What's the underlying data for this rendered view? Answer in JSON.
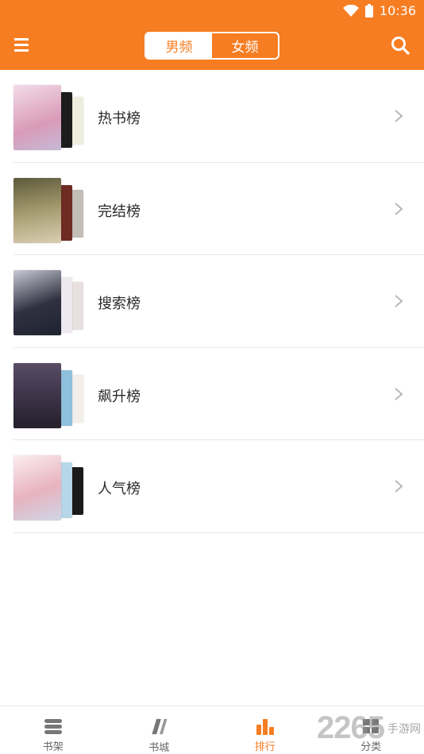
{
  "status_bar": {
    "time": "10:36",
    "wifi_icon": "wifi-icon",
    "battery_icon": "battery-icon"
  },
  "header": {
    "menu_icon": "menu-icon",
    "search_icon": "search-icon",
    "tabs": [
      {
        "label": "男频",
        "active": true
      },
      {
        "label": "女频",
        "active": false
      }
    ]
  },
  "rank_list": [
    {
      "label": "热书榜",
      "covers": [
        "#e9c6d8",
        "#1c1c1c",
        "#efeede"
      ]
    },
    {
      "label": "完结榜",
      "covers": [
        "#8a7a4a",
        "#6e2b22",
        "#c3bdb8"
      ]
    },
    {
      "label": "搜索榜",
      "covers": [
        "#2f3140",
        "#eee9ef",
        "#e8e0e0"
      ]
    },
    {
      "label": "飙升榜",
      "covers": [
        "#3d3448",
        "#8fc0dc",
        "#f2eeea"
      ]
    },
    {
      "label": "人气榜",
      "covers": [
        "#f3e0e2",
        "#b7d6e8",
        "#1a1a1a"
      ]
    }
  ],
  "bottom_nav": [
    {
      "label": "书架",
      "icon": "bookshelf-icon",
      "active": false
    },
    {
      "label": "书城",
      "icon": "bookstore-icon",
      "active": false
    },
    {
      "label": "排行",
      "icon": "ranking-icon",
      "active": true
    },
    {
      "label": "分类",
      "icon": "category-icon",
      "active": false
    }
  ],
  "watermark": {
    "number": "2265",
    "text": "手游网"
  },
  "colors": {
    "accent": "#f77d22",
    "inactive_icon": "#777777"
  }
}
